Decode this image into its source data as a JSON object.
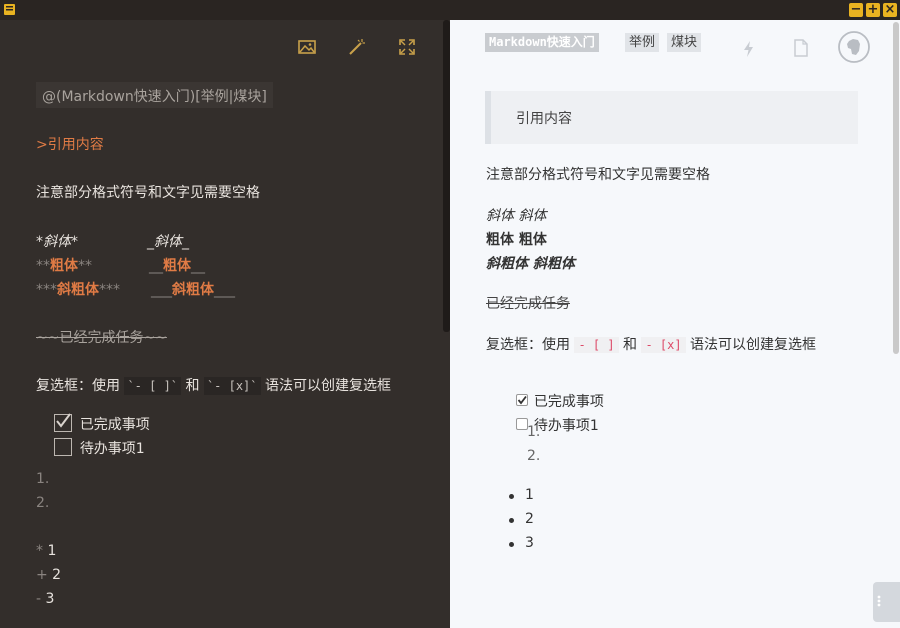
{
  "editor": {
    "tag_line": "@(Markdown快速入门)[举例|煤块]",
    "quote_line": ">引用内容",
    "spacing_note": "注意部分格式符号和文字见需要空格",
    "italic1": "*斜体*",
    "italic2": "_斜体_",
    "bold1_mark": "**",
    "bold1_text": "粗体",
    "bold2_mark": "__",
    "bold2_text": "粗体",
    "bi1_mark_l": "***",
    "bi1_text": "斜粗体",
    "bi1_mark_r": "***",
    "bi2_mark": "___",
    "bi2_text": "斜粗体",
    "strike_line": "~~已经完成任务~~",
    "checkbox_prefix": "复选框：使用 ",
    "checkbox_code1": "`- [ ]`",
    "checkbox_and": " 和 ",
    "checkbox_code2": "`- [x]`",
    "checkbox_suffix": " 语法可以创建复选框",
    "task_done": "已完成事项",
    "task_todo": "待办事项1",
    "ol1": "1.",
    "ol2": "2.",
    "ul1_mark": "*",
    "ul1": " 1",
    "ul2_mark": "+",
    "ul2": " 2",
    "ul3_mark": "-",
    "ul3": " 3"
  },
  "preview": {
    "tag1": "Markdown快速入门",
    "tag2": "举例",
    "tag3": "煤块",
    "quote": "引用内容",
    "spacing_note": "注意部分格式符号和文字见需要空格",
    "italic": "斜体 斜体",
    "bold": "粗体 粗体",
    "bold_italic": "斜粗体 斜粗体",
    "strike": "已经完成任务",
    "checkbox_prefix": "复选框：使用 ",
    "checkbox_code1": "- [ ]",
    "checkbox_and": " 和 ",
    "checkbox_code2": "- [x]",
    "checkbox_suffix": " 语法可以创建复选框",
    "task_done": "已完成事项",
    "task_todo": "待办事项1",
    "ol1": "1.",
    "ol2": "2.",
    "ul": [
      "1",
      "2",
      "3"
    ]
  },
  "icons": {
    "editor_toolbar": [
      "image-icon",
      "magic-wand-icon",
      "fullscreen-icon"
    ],
    "preview_toolbar": [
      "flash-icon",
      "document-icon",
      "evernote-icon"
    ]
  },
  "colors": {
    "accent": "#e9b321",
    "editor_bg": "#332e2b",
    "preview_bg": "#f6f8fb",
    "bold_orange": "#e07b45"
  }
}
